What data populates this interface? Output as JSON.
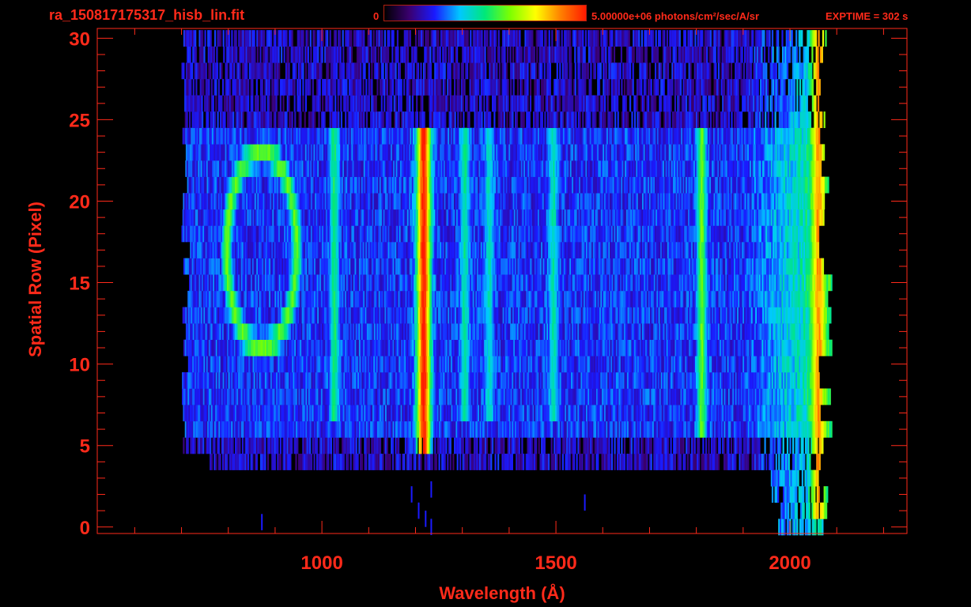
{
  "header": {
    "file_title": "ra_150817175317_hisb_lin.fit",
    "colorbar_min": "0",
    "colorbar_max": "5.00000e+06 photons/cm²/sec/A/sr",
    "exptime": "EXPTIME = 302 s"
  },
  "colors": {
    "text": "#ff2a1a",
    "frame": "#ff2a1a",
    "background": "#000000",
    "colormap": [
      "#000000",
      "#3a0070",
      "#1a1aff",
      "#00c8ff",
      "#00e878",
      "#7dff00",
      "#ffff00",
      "#ff8000",
      "#ff1a00"
    ]
  },
  "chart_data": {
    "type": "heatmap",
    "title": "ra_150817175317_hisb_lin.fit",
    "xlabel": "Wavelength (Å)",
    "ylabel": "Spatial Row (Pixel)",
    "xlim": [
      520,
      2250
    ],
    "ylim": [
      -0.4,
      30.6
    ],
    "x_ticks": [
      1000,
      1500,
      2000
    ],
    "y_ticks": [
      0,
      5,
      10,
      15,
      20,
      25,
      30
    ],
    "colorbar": {
      "min": 0,
      "max": 5000000,
      "units": "photons/cm²/sec/A/sr"
    },
    "grid": false,
    "data_extent": {
      "x": [
        700,
        2090
      ],
      "y": [
        0,
        30
      ]
    },
    "features": [
      {
        "name": "Lyman-alpha line",
        "x_center": 1216,
        "y_range": [
          5,
          24
        ],
        "relative_level": 0.95
      },
      {
        "name": "ring feature",
        "x_center": 870,
        "y_center": 17,
        "relative_level": 0.55
      },
      {
        "name": "line",
        "x_center": 1025,
        "y_range": [
          7,
          24
        ],
        "relative_level": 0.45
      },
      {
        "name": "line",
        "x_center": 1304,
        "y_range": [
          7,
          24
        ],
        "relative_level": 0.42
      },
      {
        "name": "line",
        "x_center": 1356,
        "y_range": [
          7,
          24
        ],
        "relative_level": 0.38
      },
      {
        "name": "line",
        "x_center": 1493,
        "y_range": [
          7,
          24
        ],
        "relative_level": 0.4
      },
      {
        "name": "line",
        "x_center": 1810,
        "y_range": [
          6,
          24
        ],
        "relative_level": 0.55
      },
      {
        "name": "long-wavelength edge",
        "x_center": 2060,
        "y_range": [
          1,
          30
        ],
        "relative_level": 0.8
      }
    ]
  }
}
